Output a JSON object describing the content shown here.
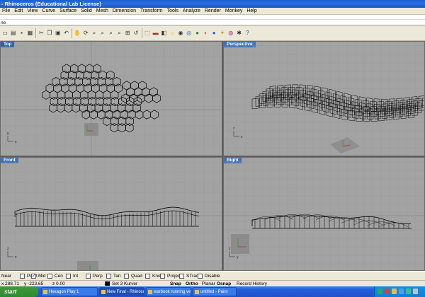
{
  "window": {
    "title": "- Rhinoceros (Educational Lab License)"
  },
  "menu": [
    "File",
    "Edit",
    "View",
    "Curve",
    "Surface",
    "Solid",
    "Mesh",
    "Dimension",
    "Transform",
    "Tools",
    "Analyze",
    "Render",
    "Monkey",
    "Help"
  ],
  "command": {
    "history": "",
    "prompt": "ne"
  },
  "toolbar_icons": [
    "new-icon",
    "open-icon",
    "save-icon",
    "print-icon",
    "cut-icon",
    "copy-icon",
    "paste-icon",
    "undo-icon",
    "pan-icon",
    "rotate-icon",
    "zoom-dynamic-icon",
    "zoom-window-icon",
    "zoom-extents-icon",
    "zoom-selected-icon",
    "zoom-all-icon",
    "undo-view-icon",
    "select-icon",
    "car-icon",
    "layer-icon",
    "light-icon",
    "properties-icon",
    "wireframe-icon",
    "shaded-icon",
    "rendered-icon",
    "sphere-icon",
    "render-icon",
    "color-wheel-icon",
    "options-icon",
    "help-icon"
  ],
  "viewports": {
    "top": {
      "label": "Top"
    },
    "perspective": {
      "label": "Perspective"
    },
    "front": {
      "label": "Front"
    },
    "right": {
      "label": "Right"
    }
  },
  "axis_labels": {
    "x": "x",
    "y": "y",
    "z": "z"
  },
  "osnap": [
    {
      "label": "Near",
      "checked": false
    },
    {
      "label": "Point",
      "checked": false
    },
    {
      "label": "Mid",
      "checked": true
    },
    {
      "label": "Cen",
      "checked": false
    },
    {
      "label": "Int",
      "checked": false
    },
    {
      "label": "Perp",
      "checked": false
    },
    {
      "label": "Tan",
      "checked": false
    },
    {
      "label": "Quad",
      "checked": false
    },
    {
      "label": "Knot",
      "checked": false
    },
    {
      "label": "Project",
      "checked": false
    },
    {
      "label": "STrack",
      "checked": false
    },
    {
      "label": "Disable",
      "checked": false
    }
  ],
  "status": {
    "x": "x 288.71",
    "y": "y -223.65",
    "z": "z 0.00",
    "layer": "Set 3 Kurver",
    "snap": "Snap",
    "ortho": "Ortho",
    "planar": "Planar",
    "osnap": "Osnap",
    "record": "Record History"
  },
  "taskbar": {
    "start": "start",
    "tasks": [
      "Hexagon Play 1",
      "New Final - Rhinocero...",
      "warbook running ven...",
      "untitled - Paint"
    ]
  }
}
